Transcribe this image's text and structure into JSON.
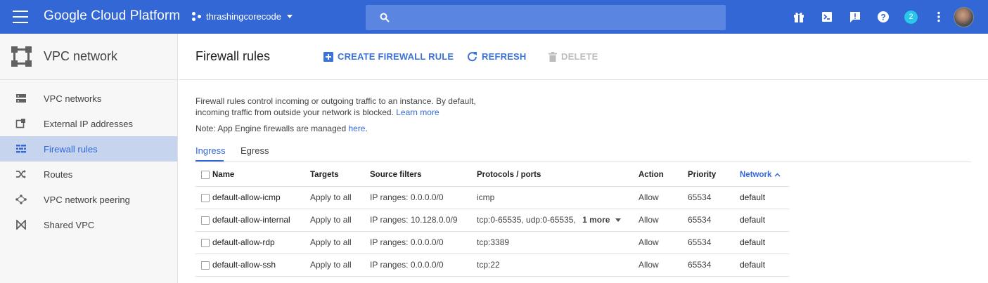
{
  "topbar": {
    "brand": "Google Cloud Platform",
    "project": "thrashingcorecode",
    "notifications_count": "2",
    "search_placeholder": ""
  },
  "sidebar": {
    "title": "VPC network",
    "items": [
      {
        "label": "VPC networks",
        "icon": "vpc-networks-icon"
      },
      {
        "label": "External IP addresses",
        "icon": "external-ip-icon"
      },
      {
        "label": "Firewall rules",
        "icon": "firewall-icon",
        "active": true
      },
      {
        "label": "Routes",
        "icon": "routes-icon"
      },
      {
        "label": "VPC network peering",
        "icon": "peering-icon"
      },
      {
        "label": "Shared VPC",
        "icon": "shared-vpc-icon"
      }
    ]
  },
  "main": {
    "title": "Firewall rules",
    "actions": {
      "create": "CREATE FIREWALL RULE",
      "refresh": "REFRESH",
      "delete": "DELETE"
    },
    "description_1": "Firewall rules control incoming or outgoing traffic to an instance. By default,",
    "description_2": "incoming traffic from outside your network is blocked.",
    "learn_more": "Learn more",
    "note_prefix": "Note: App Engine firewalls are managed",
    "note_link": "here",
    "note_suffix": ".",
    "tabs": [
      "Ingress",
      "Egress"
    ]
  },
  "table": {
    "columns": [
      "Name",
      "Targets",
      "Source filters",
      "Protocols / ports",
      "Action",
      "Priority",
      "Network"
    ],
    "sorted_column": "Network",
    "rows": [
      {
        "name": "default-allow-icmp",
        "targets": "Apply to all",
        "source": "IP ranges: 0.0.0.0/0",
        "protocols": "icmp",
        "more": "",
        "action": "Allow",
        "priority": "65534",
        "network": "default"
      },
      {
        "name": "default-allow-internal",
        "targets": "Apply to all",
        "source": "IP ranges: 10.128.0.0/9",
        "protocols": "tcp:0-65535, udp:0-65535,",
        "more": "1 more",
        "action": "Allow",
        "priority": "65534",
        "network": "default"
      },
      {
        "name": "default-allow-rdp",
        "targets": "Apply to all",
        "source": "IP ranges: 0.0.0.0/0",
        "protocols": "tcp:3389",
        "more": "",
        "action": "Allow",
        "priority": "65534",
        "network": "default"
      },
      {
        "name": "default-allow-ssh",
        "targets": "Apply to all",
        "source": "IP ranges: 0.0.0.0/0",
        "protocols": "tcp:22",
        "more": "",
        "action": "Allow",
        "priority": "65534",
        "network": "default"
      }
    ]
  },
  "colors": {
    "topbar": "#3367d6",
    "accent": "#3367d6",
    "sidebar_active": "#c6d4ee",
    "badge": "#28c6e8"
  }
}
